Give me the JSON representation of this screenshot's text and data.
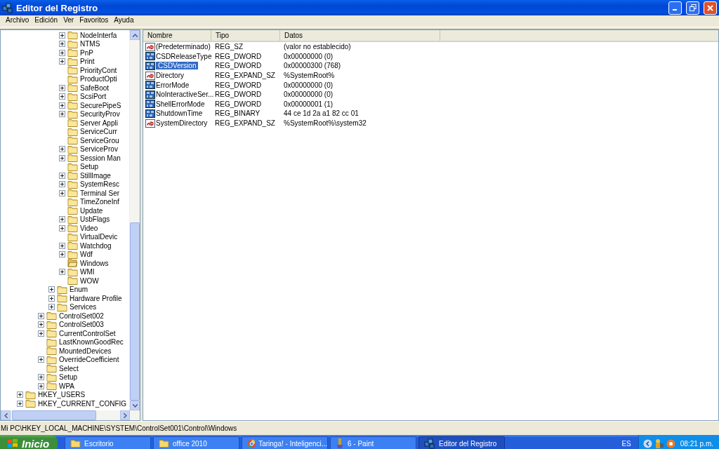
{
  "window": {
    "title": "Editor del Registro"
  },
  "menu": [
    "Archivo",
    "Edición",
    "Ver",
    "Favoritos",
    "Ayuda"
  ],
  "tree": [
    {
      "children": [
        {
          "children": [
            {
              "children": [
                {
                  "children": [
                    {
                      "label": "NodeInterfa",
                      "expandable": true,
                      "selected": false
                    },
                    {
                      "label": "NTMS",
                      "expandable": true,
                      "selected": false
                    },
                    {
                      "label": "PnP",
                      "expandable": true,
                      "selected": false
                    },
                    {
                      "label": "Print",
                      "expandable": true,
                      "selected": false
                    },
                    {
                      "label": "PriorityCont",
                      "expandable": false,
                      "selected": false
                    },
                    {
                      "label": "ProductOpti",
                      "expandable": false,
                      "selected": false
                    },
                    {
                      "label": "SafeBoot",
                      "expandable": true,
                      "selected": false
                    },
                    {
                      "label": "ScsiPort",
                      "expandable": true,
                      "selected": false
                    },
                    {
                      "label": "SecurePipeS",
                      "expandable": true,
                      "selected": false
                    },
                    {
                      "label": "SecurityProv",
                      "expandable": true,
                      "selected": false
                    },
                    {
                      "label": "Server Appli",
                      "expandable": false,
                      "selected": false
                    },
                    {
                      "label": "ServiceCurr",
                      "expandable": false,
                      "selected": false
                    },
                    {
                      "label": "ServiceGrou",
                      "expandable": false,
                      "selected": false
                    },
                    {
                      "label": "ServiceProv",
                      "expandable": true,
                      "selected": false
                    },
                    {
                      "label": "Session Man",
                      "expandable": true,
                      "selected": false
                    },
                    {
                      "label": "Setup",
                      "expandable": false,
                      "selected": false
                    },
                    {
                      "label": "StillImage",
                      "expandable": true,
                      "selected": false
                    },
                    {
                      "label": "SystemResc",
                      "expandable": true,
                      "selected": false
                    },
                    {
                      "label": "Terminal Ser",
                      "expandable": true,
                      "selected": false
                    },
                    {
                      "label": "TimeZoneInf",
                      "expandable": false,
                      "selected": false
                    },
                    {
                      "label": "Update",
                      "expandable": false,
                      "selected": false
                    },
                    {
                      "label": "UsbFlags",
                      "expandable": true,
                      "selected": false
                    },
                    {
                      "label": "Video",
                      "expandable": true,
                      "selected": false
                    },
                    {
                      "label": "VirtualDevic",
                      "expandable": false,
                      "selected": false
                    },
                    {
                      "label": "Watchdog",
                      "expandable": true,
                      "selected": false
                    },
                    {
                      "label": "Wdf",
                      "expandable": true,
                      "selected": false
                    },
                    {
                      "label": "Windows",
                      "expandable": false,
                      "selected": true
                    },
                    {
                      "label": "WMI",
                      "expandable": true,
                      "selected": false
                    },
                    {
                      "label": "WOW",
                      "expandable": false,
                      "selected": false
                    }
                  ]
                },
                {
                  "label": "Enum",
                  "expandable": true,
                  "selected": false
                },
                {
                  "label": "Hardware Profile",
                  "expandable": true,
                  "selected": false
                },
                {
                  "label": "Services",
                  "expandable": true,
                  "selected": false
                }
              ]
            },
            {
              "label": "ControlSet002",
              "expandable": true,
              "selected": false
            },
            {
              "label": "ControlSet003",
              "expandable": true,
              "selected": false
            },
            {
              "label": "CurrentControlSet",
              "expandable": true,
              "selected": false
            },
            {
              "label": "LastKnownGoodRec",
              "expandable": false,
              "selected": false
            },
            {
              "label": "MountedDevices",
              "expandable": false,
              "selected": false
            },
            {
              "label": "OverrideCoefficient",
              "expandable": true,
              "selected": false
            },
            {
              "label": "Select",
              "expandable": false,
              "selected": false
            },
            {
              "label": "Setup",
              "expandable": true,
              "selected": false
            },
            {
              "label": "WPA",
              "expandable": true,
              "selected": false
            }
          ]
        }
      ]
    },
    {
      "label": "HKEY_USERS",
      "expandable": true,
      "selected": false
    },
    {
      "label": "HKEY_CURRENT_CONFIG",
      "expandable": true,
      "selected": false
    }
  ],
  "list": {
    "columns": [
      "Nombre",
      "Tipo",
      "Datos"
    ],
    "rows": [
      {
        "kind": "string",
        "name": "(Predeterminado)",
        "type": "REG_SZ",
        "data": "(valor no establecido)",
        "selected": false
      },
      {
        "kind": "binary",
        "name": "CSDReleaseType",
        "type": "REG_DWORD",
        "data": "0x00000000 (0)",
        "selected": false
      },
      {
        "kind": "binary",
        "name": "CSDVersion",
        "type": "REG_DWORD",
        "data": "0x00000300 (768)",
        "selected": true
      },
      {
        "kind": "string",
        "name": "Directory",
        "type": "REG_EXPAND_SZ",
        "data": "%SystemRoot%",
        "selected": false
      },
      {
        "kind": "binary",
        "name": "ErrorMode",
        "type": "REG_DWORD",
        "data": "0x00000000 (0)",
        "selected": false
      },
      {
        "kind": "binary",
        "name": "NoInteractiveSer...",
        "type": "REG_DWORD",
        "data": "0x00000000 (0)",
        "selected": false
      },
      {
        "kind": "binary",
        "name": "ShellErrorMode",
        "type": "REG_DWORD",
        "data": "0x00000001 (1)",
        "selected": false
      },
      {
        "kind": "binary",
        "name": "ShutdownTime",
        "type": "REG_BINARY",
        "data": "44 ce 1d 2a a1 82 cc 01",
        "selected": false
      },
      {
        "kind": "string",
        "name": "SystemDirectory",
        "type": "REG_EXPAND_SZ",
        "data": "%SystemRoot%\\system32",
        "selected": false
      }
    ]
  },
  "status_bar": "Mi PC\\HKEY_LOCAL_MACHINE\\SYSTEM\\ControlSet001\\Control\\Windows",
  "taskbar": {
    "start": "Inicio",
    "tasks": [
      {
        "kind": "folder",
        "label": "Escritorio",
        "selected": false
      },
      {
        "kind": "folder",
        "label": "office 2010",
        "selected": false
      },
      {
        "kind": "browser",
        "label": "Taringa! - Inteligenci...",
        "selected": false
      },
      {
        "kind": "paint",
        "label": "6 - Paint",
        "selected": false
      },
      {
        "kind": "regedit",
        "label": "Editor del Registro",
        "selected": true
      }
    ],
    "language": "ES",
    "clock": "08:21 p.m."
  }
}
